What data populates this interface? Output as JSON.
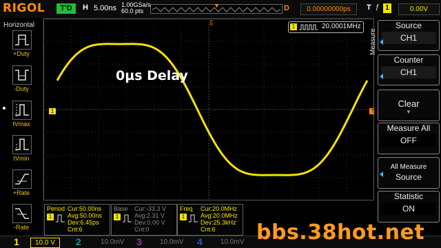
{
  "header": {
    "logo": "RIGOL",
    "run_state": "T'D",
    "h_label": "H",
    "timebase": "5.00ns",
    "sample_rate": "1.00GSa/s",
    "memory_depth": "60.0 pts",
    "delay_label": "D",
    "delay_value": "0.00000000ps",
    "trigger_label": "T",
    "trigger_source": "1",
    "trigger_level": "0.00V"
  },
  "left_menu": {
    "title": "Horizontal",
    "items": [
      {
        "label": "+Duty",
        "icon": "positive-duty-icon"
      },
      {
        "label": "-Duty",
        "icon": "negative-duty-icon"
      },
      {
        "label": "tVmax",
        "icon": "tvmax-icon"
      },
      {
        "label": "tVmin",
        "icon": "tvmin-icon"
      },
      {
        "label": "+Rate",
        "icon": "rise-rate-icon"
      },
      {
        "label": "-Rate",
        "icon": "fall-rate-icon"
      }
    ]
  },
  "display": {
    "overlay_text": "0µs Delay",
    "counter_channel": "1",
    "counter_value": "20.0001MHz",
    "waveform_color": "#f5e400"
  },
  "right_menu": {
    "vertical_title": "Measure",
    "source_title": "Source",
    "source_value": "CH1",
    "counter_title": "Counter",
    "counter_value": "CH1",
    "clear_label": "Clear",
    "measure_all_title": "Measure All",
    "measure_all_value": "OFF",
    "all_measure_title": "All Measure",
    "all_measure_value": "Source",
    "statistic_title": "Statistic",
    "statistic_value": "ON"
  },
  "measurements": [
    {
      "name": "Period",
      "channel": "1",
      "lines": [
        "Cur:50.00ns",
        "Avg:50.00ns",
        "Dev:6.45ps",
        "Cnt:6"
      ]
    },
    {
      "name": "Base",
      "channel": "1",
      "lines": [
        "Cur:-33.3 V",
        "Avg:2.31 V",
        "Dev:0.00 V",
        "Cnt:0"
      ]
    },
    {
      "name": "Freq",
      "channel": "1",
      "lines": [
        "Cur:20.0MHz",
        "Avg:20.0MHz",
        "Dev:25.3kHz",
        "Cnt:6"
      ]
    }
  ],
  "channels": [
    {
      "num": "1",
      "value": "10.0 V",
      "color": "#f5e400"
    },
    {
      "num": "2",
      "value": "10.0mV",
      "color": "#00e0e0"
    },
    {
      "num": "3",
      "value": "10.0mV",
      "color": "#e040e0"
    },
    {
      "num": "4",
      "value": "10.0mV",
      "color": "#4070ff"
    }
  ],
  "watermark": "bbs.38hot.net"
}
